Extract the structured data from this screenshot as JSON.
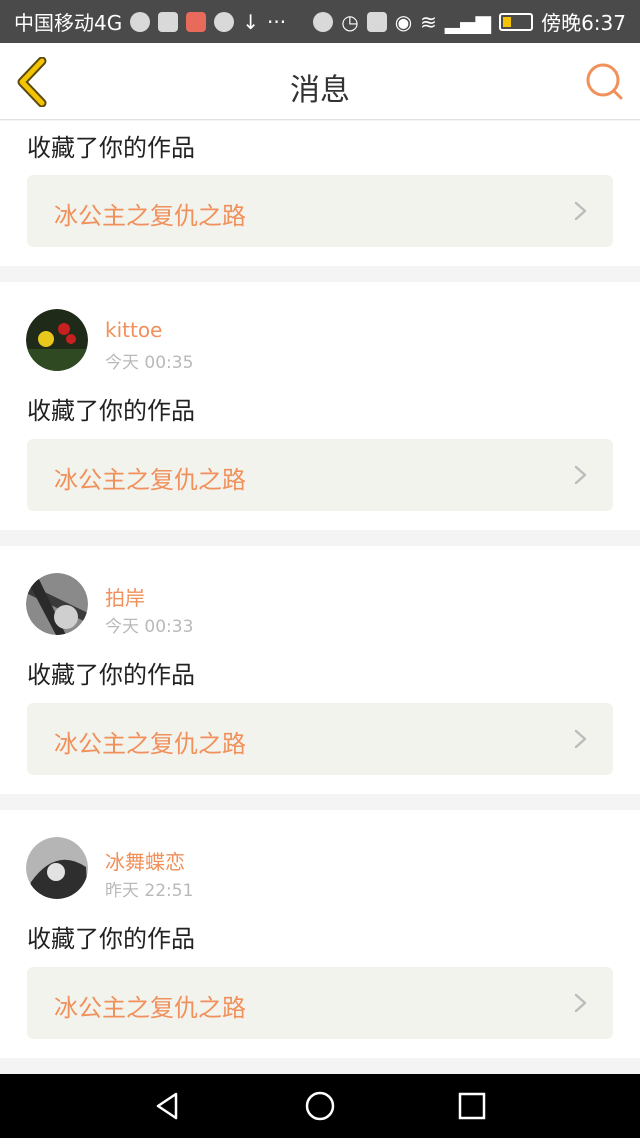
{
  "status_bar": {
    "carrier": "中国移动4G",
    "overflow": "···",
    "time": "傍晚6:37"
  },
  "header": {
    "title": "消息"
  },
  "feed": {
    "partial_item": {
      "action": "收藏了你的作品",
      "work_title": "冰公主之复仇之路"
    },
    "items": [
      {
        "username": "kittoe",
        "time": "今天 00:35",
        "action": "收藏了你的作品",
        "work_title": "冰公主之复仇之路"
      },
      {
        "username": "拍岸",
        "time": "今天 00:33",
        "action": "收藏了你的作品",
        "work_title": "冰公主之复仇之路"
      },
      {
        "username": "冰舞蝶恋",
        "time": "昨天 22:51",
        "action": "收藏了你的作品",
        "work_title": "冰公主之复仇之路"
      }
    ]
  },
  "icons": {
    "back": "chevron-left-icon",
    "search": "search-icon",
    "link": "chevron-right-icon",
    "nav_back": "triangle-back-icon",
    "nav_home": "circle-home-icon",
    "nav_recent": "square-recent-icon"
  },
  "colors": {
    "accent": "#f0905a",
    "back_arrow": "#f5c400",
    "link_bg": "#f3f3ee",
    "status_bar": "#4a4a4a"
  }
}
